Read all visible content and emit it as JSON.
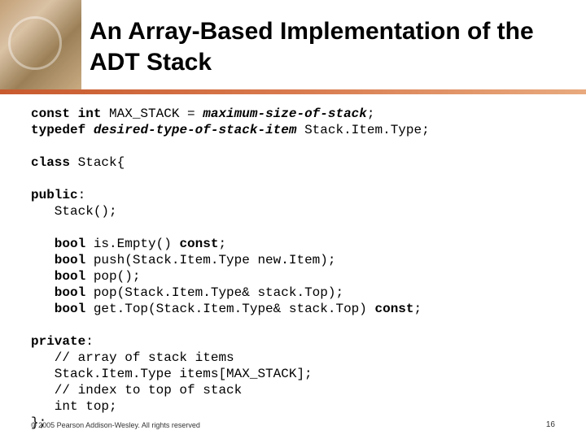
{
  "title": "An Array-Based Implementation of the ADT Stack",
  "code": {
    "l1a": "const int",
    "l1b": " MAX_STACK = ",
    "l1c": "maximum-size-of-stack",
    "l1d": ";",
    "l2a": "typedef",
    "l2b": " ",
    "l2c": "desired-type-of-stack-item",
    "l2d": " Stack.Item.Type;",
    "l3a": "class",
    "l3b": " Stack{",
    "l4a": "public",
    "l4b": ":",
    "l5": "   Stack();",
    "l6a": "   bool",
    "l6b": " is.Empty() ",
    "l6c": "const",
    "l6d": ";",
    "l7a": "   bool",
    "l7b": " push(Stack.Item.Type new.Item);",
    "l8a": "   bool",
    "l8b": " pop();",
    "l9a": "   bool",
    "l9b": " pop(Stack.Item.Type& stack.Top);",
    "l10a": "   bool",
    "l10b": " get.Top(Stack.Item.Type& stack.Top) ",
    "l10c": "const",
    "l10d": ";",
    "l11a": "private",
    "l11b": ":",
    "l12": "   // array of stack items",
    "l13": "   Stack.Item.Type items[MAX_STACK];",
    "l14": "   // index to top of stack",
    "l15": "   int top;",
    "l16": "};"
  },
  "footer": "© 2005 Pearson Addison-Wesley. All rights reserved",
  "page_number": "16"
}
